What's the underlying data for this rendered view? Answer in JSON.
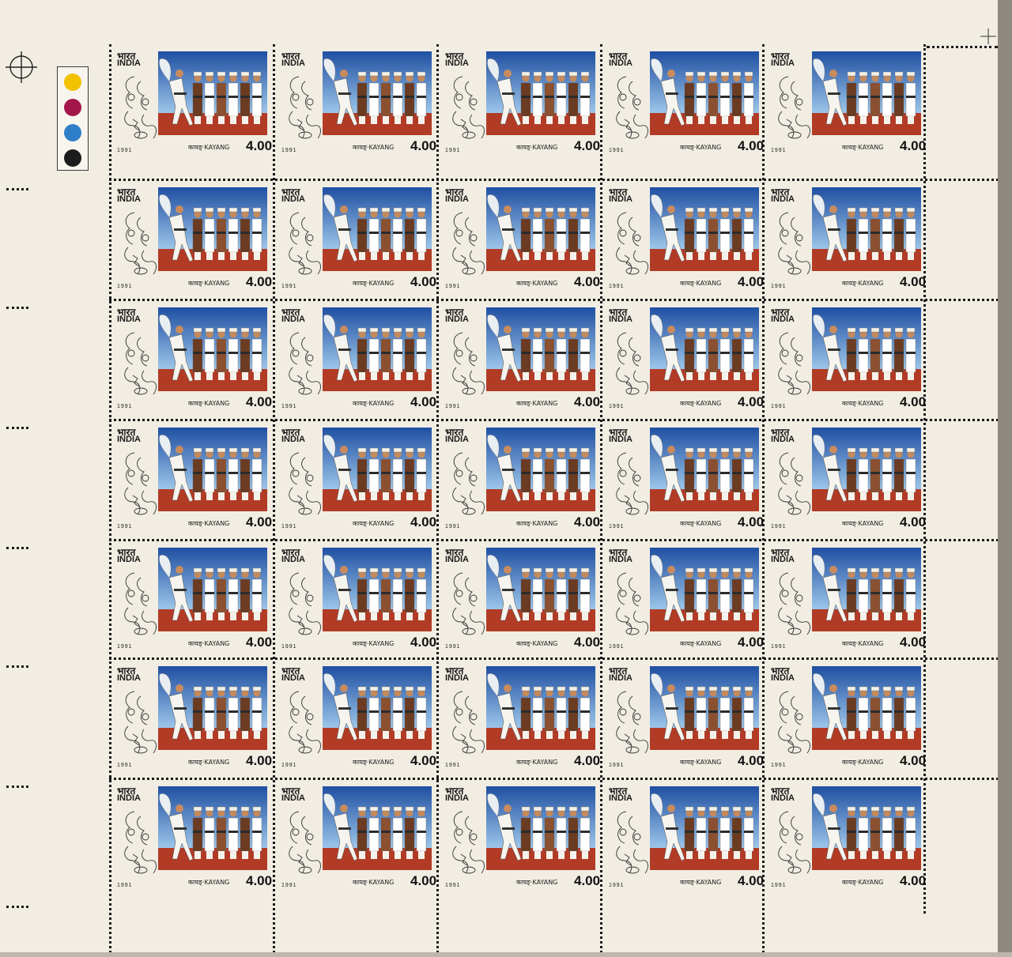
{
  "sheet": {
    "rows": 7,
    "columns": 5,
    "stamp": {
      "country_hindi": "भारत",
      "country": "INDIA",
      "year": "1991",
      "caption": "कायङ्·KAYANG",
      "value": "4.00"
    }
  },
  "margin": {
    "color_markers": [
      {
        "name": "yellow",
        "color": "#f2c200"
      },
      {
        "name": "magenta",
        "color": "#a3164a"
      },
      {
        "name": "cyan",
        "color": "#2f7fc8"
      },
      {
        "name": "black",
        "color": "#1c1c1c"
      }
    ]
  },
  "colors": {
    "sky_top": "#1f4fa2",
    "sky_bottom": "#9cc6ea",
    "ground": "#b23b26",
    "paper": "#f1ede3"
  }
}
